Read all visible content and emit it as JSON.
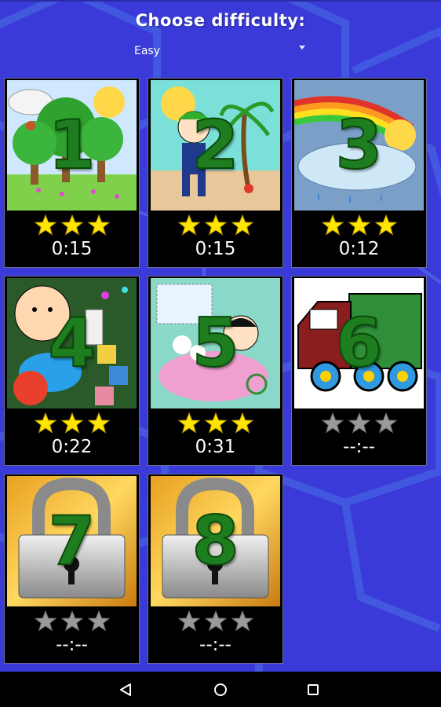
{
  "header": {
    "title": "Choose difficulty:"
  },
  "difficulty": {
    "selected": "Easy"
  },
  "levels": [
    {
      "number": "1",
      "time": "0:15",
      "stars": 3,
      "locked": false,
      "scene": "trees"
    },
    {
      "number": "2",
      "time": "0:15",
      "stars": 3,
      "locked": false,
      "scene": "pirate"
    },
    {
      "number": "3",
      "time": "0:12",
      "stars": 3,
      "locked": false,
      "scene": "rainbow"
    },
    {
      "number": "4",
      "time": "0:22",
      "stars": 3,
      "locked": false,
      "scene": "baby"
    },
    {
      "number": "5",
      "time": "0:31",
      "stars": 3,
      "locked": false,
      "scene": "bath"
    },
    {
      "number": "6",
      "time": "--:--",
      "stars": 0,
      "locked": false,
      "scene": "truck"
    },
    {
      "number": "7",
      "time": "--:--",
      "stars": 0,
      "locked": true,
      "scene": "lock"
    },
    {
      "number": "8",
      "time": "--:--",
      "stars": 0,
      "locked": true,
      "scene": "lock"
    }
  ],
  "colors": {
    "background": "#3b3bd9",
    "star_on": "#ffe600",
    "star_off": "#9a9a9a",
    "number": "#1e7d1e"
  },
  "nav": {
    "back_icon": "back-icon",
    "home_icon": "home-icon",
    "recents_icon": "recents-icon"
  }
}
